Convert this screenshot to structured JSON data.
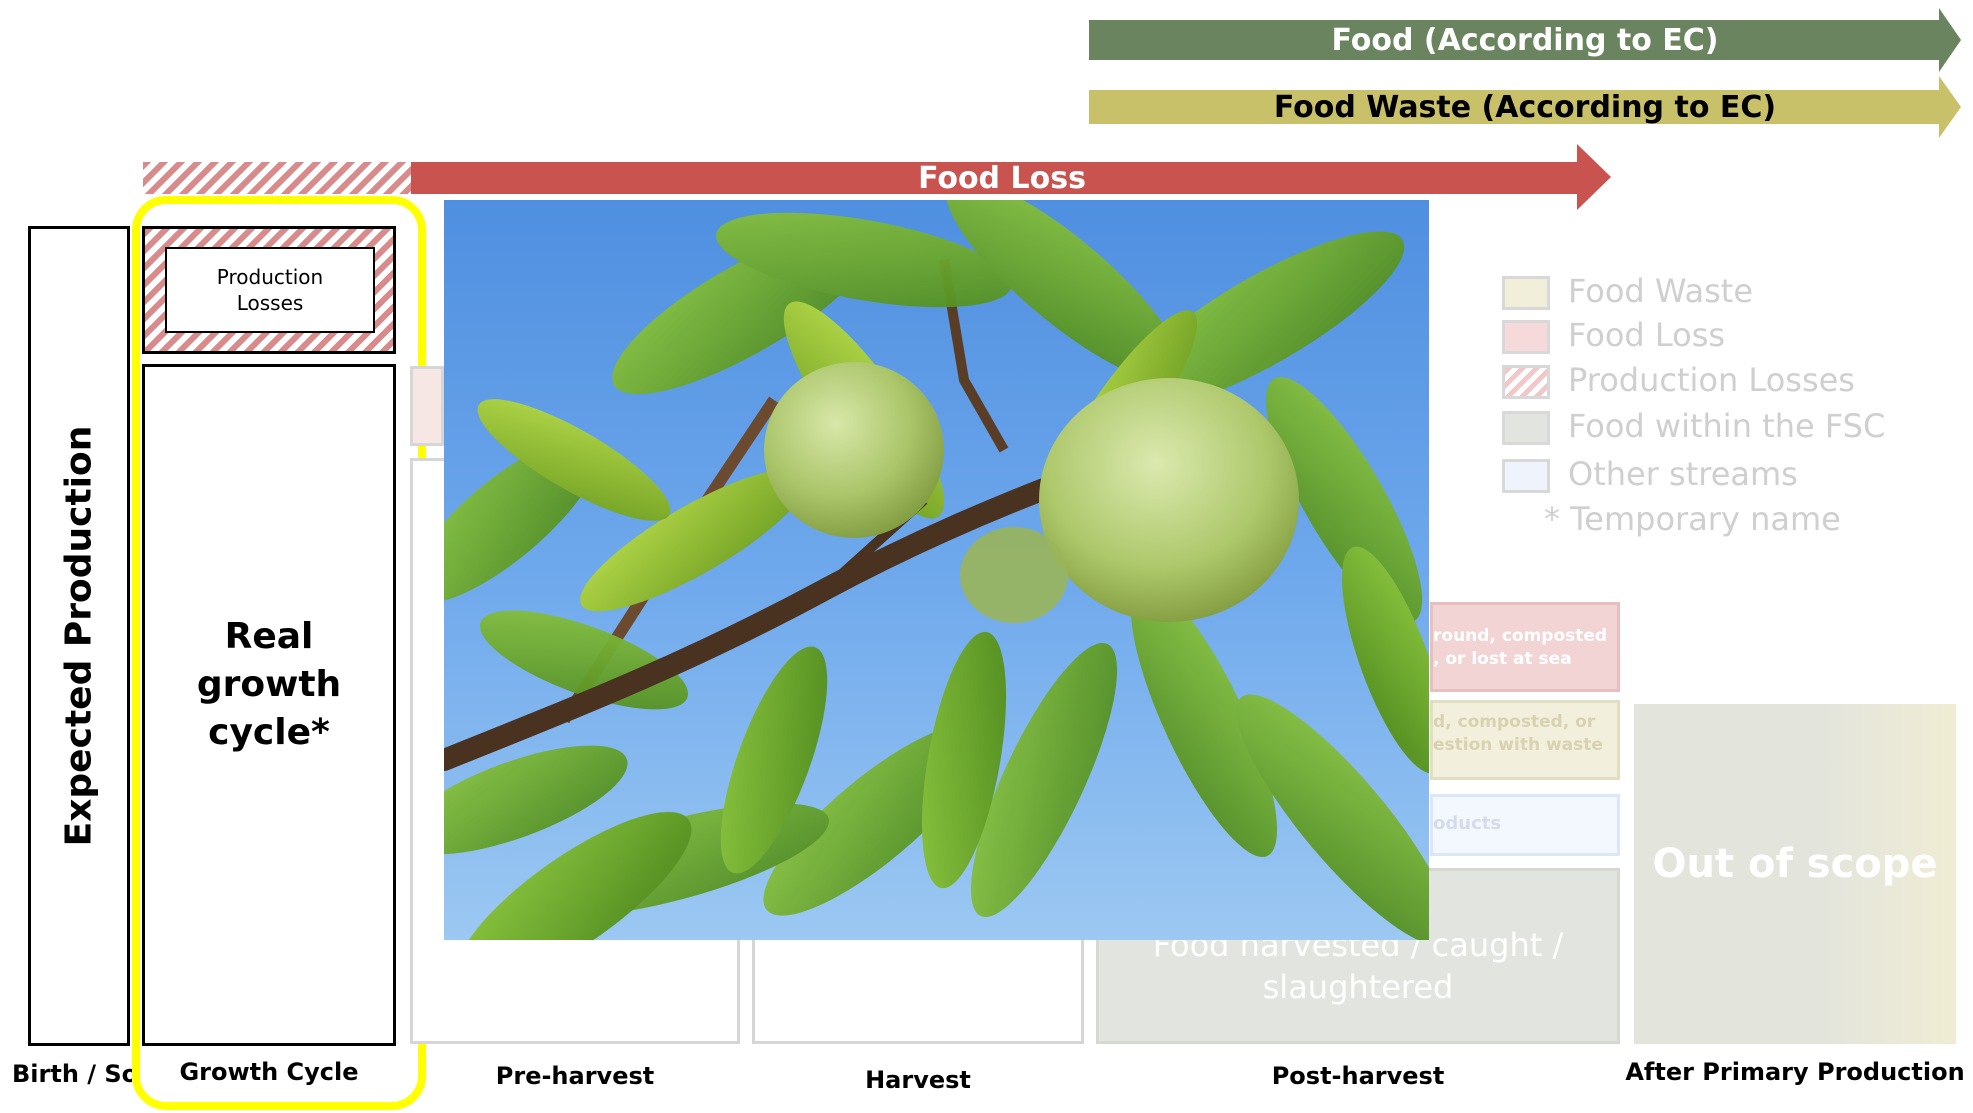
{
  "arrows": {
    "food_ec": "Food (According to EC)",
    "food_waste_ec": "Food Waste (According to EC)",
    "food_loss": "Food Loss"
  },
  "colors": {
    "food_ec": "#6b8460",
    "food_waste_ec": "#c9c06a",
    "food_loss": "#c9544f",
    "highlight": "#ffff00"
  },
  "diagram": {
    "expected_production": "Expected Production",
    "production_losses": "Production Losses",
    "real_growth_cycle": "Real growth cycle*",
    "faded_boxes": {
      "ground_composted": "round, composted\n, or lost at sea",
      "composted_or": "d, composted, or\nestion with waste",
      "oducts": "oducts",
      "food_harvested": "Food harvested / caught /\nslaughtered",
      "out_of_scope": "Out of scope"
    }
  },
  "legend": [
    {
      "label": "Food Waste",
      "color": "#f1efd9",
      "hatch": false
    },
    {
      "label": "Food Loss",
      "color": "#f6d9da",
      "hatch": false
    },
    {
      "label": "Production Losses",
      "color": "#ffffff",
      "hatch": true
    },
    {
      "label": "Food within the FSC",
      "color": "#e2e5df",
      "hatch": false
    },
    {
      "label": "Other streams",
      "color": "#eef3fc",
      "hatch": false
    }
  ],
  "legend_note": "* Temporary name",
  "stages": {
    "birth": "Birth / Sow",
    "growth": "Growth Cycle",
    "preharvest": "Pre-harvest",
    "harvest": "Harvest",
    "postharvest": "Post-harvest",
    "after": "After Primary Production"
  },
  "photo": {
    "icon": "peach-branch-photo"
  }
}
